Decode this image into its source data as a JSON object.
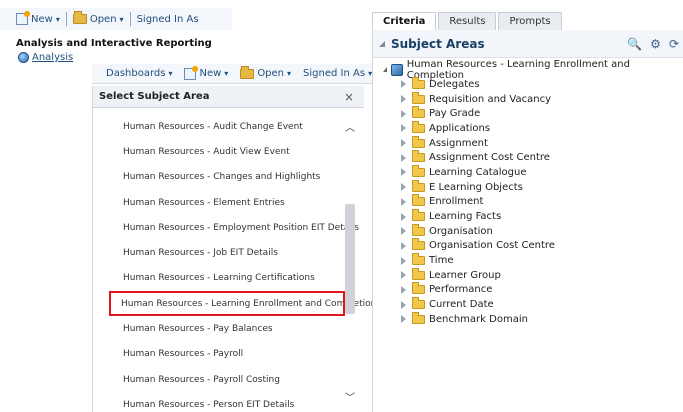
{
  "top_toolbar": {
    "new_label": "New",
    "open_label": "Open",
    "signed_in_label": "Signed In As"
  },
  "catalog": {
    "section_title": "Analysis and Interactive Reporting",
    "analysis_link": "Analysis"
  },
  "second_toolbar": {
    "dashboards_label": "Dashboards",
    "new_label": "New",
    "open_label": "Open",
    "signed_in_label": "Signed In As"
  },
  "select_subject_area": {
    "title": "Select Subject Area",
    "close_symbol": "×",
    "items": [
      "Human Resources - Audit Change Event",
      "Human Resources - Audit View Event",
      "Human Resources - Changes and Highlights",
      "Human Resources - Element Entries",
      "Human Resources - Employment Position EIT Details",
      "Human Resources - Job EIT Details",
      "Human Resources - Learning Certifications",
      "Human Resources - Learning Enrollment and Completion",
      "Human Resources - Pay Balances",
      "Human Resources - Payroll",
      "Human Resources - Payroll Costing",
      "Human Resources - Person EIT Details"
    ],
    "selected_index": 7,
    "highlight_color": "#e0161c"
  },
  "tabs": [
    "Criteria",
    "Results",
    "Prompts"
  ],
  "subject_areas": {
    "title": "Subject Areas",
    "root": "Human Resources - Learning Enrollment and Completion",
    "folders": [
      "Delegates",
      "Requisition and Vacancy",
      "Pay Grade",
      "Applications",
      "Assignment",
      "Assignment Cost Centre",
      "Learning Catalogue",
      "E Learning Objects",
      "Enrollment",
      "Learning Facts",
      "Organisation",
      "Organisation Cost Centre",
      "Time",
      "Learner Group",
      "Performance",
      "Current Date",
      "Benchmark Domain"
    ]
  }
}
